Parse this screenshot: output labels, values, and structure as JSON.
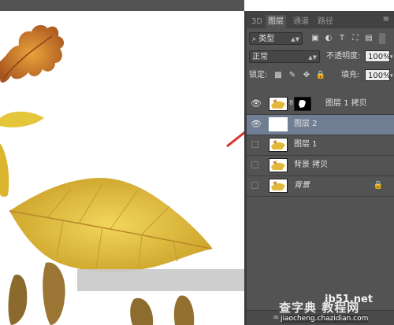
{
  "panel": {
    "tabs": [
      {
        "label": "3D"
      },
      {
        "label": "图层"
      },
      {
        "label": "通道"
      },
      {
        "label": "路径"
      }
    ],
    "filter": {
      "label": "类型"
    },
    "blend_mode": "正常",
    "opacity": {
      "label": "不透明度:",
      "value": "100%"
    },
    "lock": {
      "label": "锁定:"
    },
    "fill": {
      "label": "填充:",
      "value": "100%"
    },
    "layers": [
      {
        "name": "图层 1 拷贝",
        "visible": true,
        "selected": false
      },
      {
        "name": "图层 2",
        "visible": true,
        "selected": true
      },
      {
        "name": "图层 1",
        "visible": false,
        "selected": false
      },
      {
        "name": "背景 拷贝",
        "visible": false,
        "selected": false
      },
      {
        "name": "背景",
        "visible": false,
        "selected": false,
        "locked": true
      }
    ]
  },
  "watermark": {
    "line1": "ib51.net",
    "line2": "jiaocheng.chazidian.com",
    "site": "查字典 教程网"
  },
  "colors": {
    "panel_bg": "#535353",
    "selected_layer": "#6f7e93",
    "arrow": "#e0312b",
    "leaf_yellow": "#e8c436",
    "leaf_orange": "#d9892c"
  }
}
